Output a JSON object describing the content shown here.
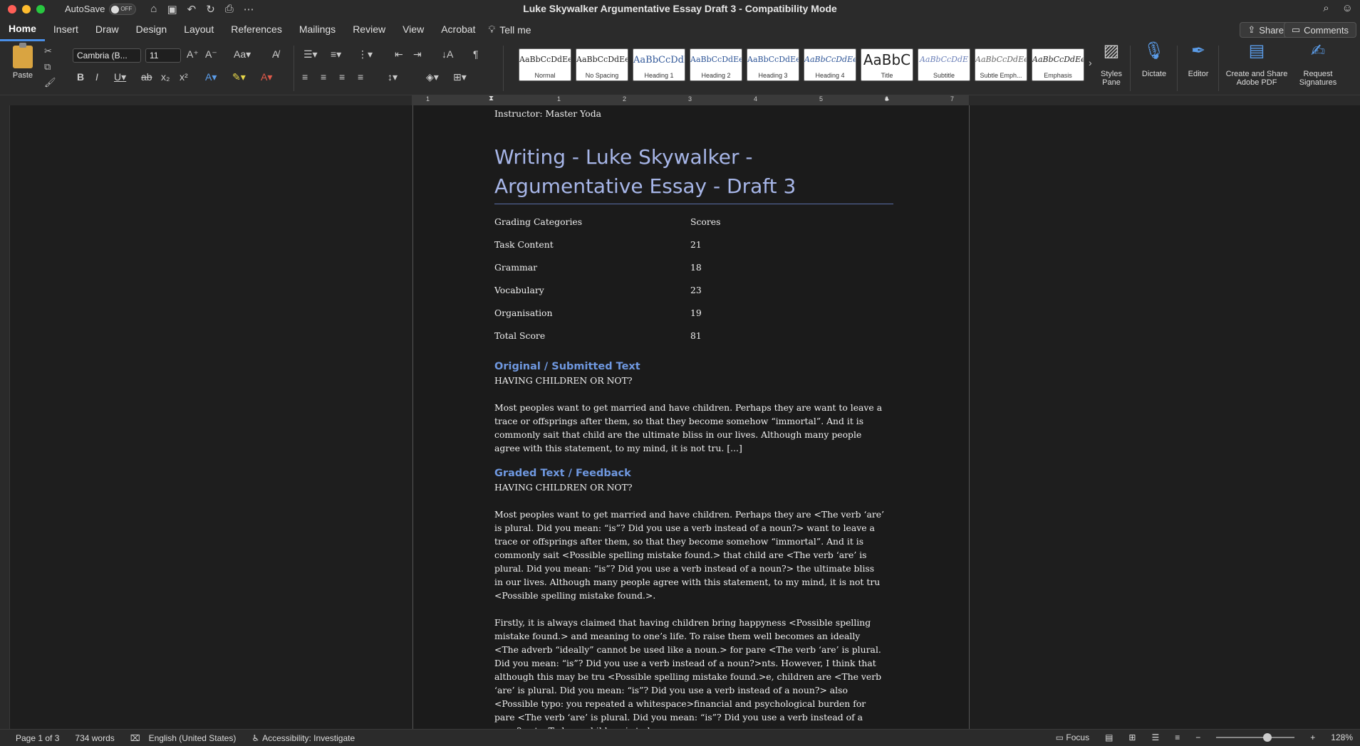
{
  "titlebar": {
    "autosave_label": "AutoSave",
    "autosave_state": "OFF",
    "doc_title": "Luke Skywalker Argumentative Essay Draft 3  -  Compatibility Mode"
  },
  "tabs": [
    "Home",
    "Insert",
    "Draw",
    "Design",
    "Layout",
    "References",
    "Mailings",
    "Review",
    "View",
    "Acrobat"
  ],
  "tell_me": "Tell me",
  "share_label": "Share",
  "comments_label": "Comments",
  "ribbon": {
    "paste_label": "Paste",
    "font_name": "Cambria (B...",
    "font_size": "11",
    "styles": [
      {
        "preview": "AaBbCcDdEe",
        "name": "Normal"
      },
      {
        "preview": "AaBbCcDdEe",
        "name": "No Spacing"
      },
      {
        "preview": "AaBbCcDdI",
        "name": "Heading 1"
      },
      {
        "preview": "AaBbCcDdEe",
        "name": "Heading 2"
      },
      {
        "preview": "AaBbCcDdEe",
        "name": "Heading 3"
      },
      {
        "preview": "AaBbCcDdEe",
        "name": "Heading 4"
      },
      {
        "preview": "AaBbC",
        "name": "Title"
      },
      {
        "preview": "AaBbCcDdE",
        "name": "Subtitle"
      },
      {
        "preview": "AaBbCcDdEe",
        "name": "Subtle Emph..."
      },
      {
        "preview": "AaBbCcDdEe",
        "name": "Emphasis"
      }
    ],
    "styles_pane": "Styles Pane",
    "dictate": "Dictate",
    "editor": "Editor",
    "create_share_pdf": "Create and Share Adobe PDF",
    "request_signatures": "Request Signatures"
  },
  "ruler_numbers": [
    "1",
    "1",
    "2",
    "3",
    "4",
    "5",
    "6",
    "7"
  ],
  "document": {
    "instructor": "Instructor: Master Yoda",
    "heading": "Writing - Luke Skywalker - Argumentative Essay - Draft 3",
    "grades_header": [
      "Grading Categories",
      "Scores"
    ],
    "grades": [
      [
        "Task Content",
        "21"
      ],
      [
        "Grammar",
        "18"
      ],
      [
        "Vocabulary",
        "23"
      ],
      [
        "Organisation",
        "19"
      ],
      [
        "Total Score",
        "81"
      ]
    ],
    "section1_title": "Original / Submitted Text",
    "section1_subtitle": "HAVING CHILDREN OR NOT?",
    "section1_para": "Most peoples want to get married and have children. Perhaps they are want to leave a trace or offsprings after them, so that they become somehow “immortal”. And it is commonly sait that child are the ultimate bliss in our lives. Although many people agree with this statement, to my mind, it is not tru. [...]",
    "section2_title": "Graded Text / Feedback",
    "section2_subtitle": "HAVING CHILDREN OR NOT?",
    "section2_para1": "Most peoples want to get married and have children. Perhaps they are <The verb ‘are’ is plural. Did you mean: “is”? Did you use a verb instead of a noun?> want to leave a trace or offsprings after them, so that they become somehow “immortal”. And it is commonly sait <Possible spelling mistake found.> that child are <The verb ‘are’ is plural. Did you mean: “is”? Did you use a verb instead of a noun?> the ultimate bliss in our lives. Although many people agree with this statement, to my mind, it is not tru <Possible spelling mistake found.>.",
    "section2_para2": "Firstly, it is always claimed that having children bring happyness <Possible spelling mistake found.> and meaning to one’s life. To raise them well becomes an ideally <The adverb “ideally” cannot be used like a noun.> for pare <The verb ‘are’ is plural. Did you mean: “is”? Did you use a verb instead of a noun?>nts. However, I think that although this may be tru <Possible spelling mistake found.>e, children are <The verb ‘are’ is plural. Did you mean: “is”? Did you use a verb instead of a noun?> also   <Possible typo: you repeated a whitespace>financial and psychological burden for pare <The verb ‘are’ is plural. Did you mean: “is”? Did you use a verb instead of a noun?>nts. To have children is to have"
  },
  "status": {
    "page": "Page 1 of 3",
    "words": "734 words",
    "language": "English (United States)",
    "accessibility": "Accessibility: Investigate",
    "focus": "Focus",
    "zoom": "128%"
  }
}
